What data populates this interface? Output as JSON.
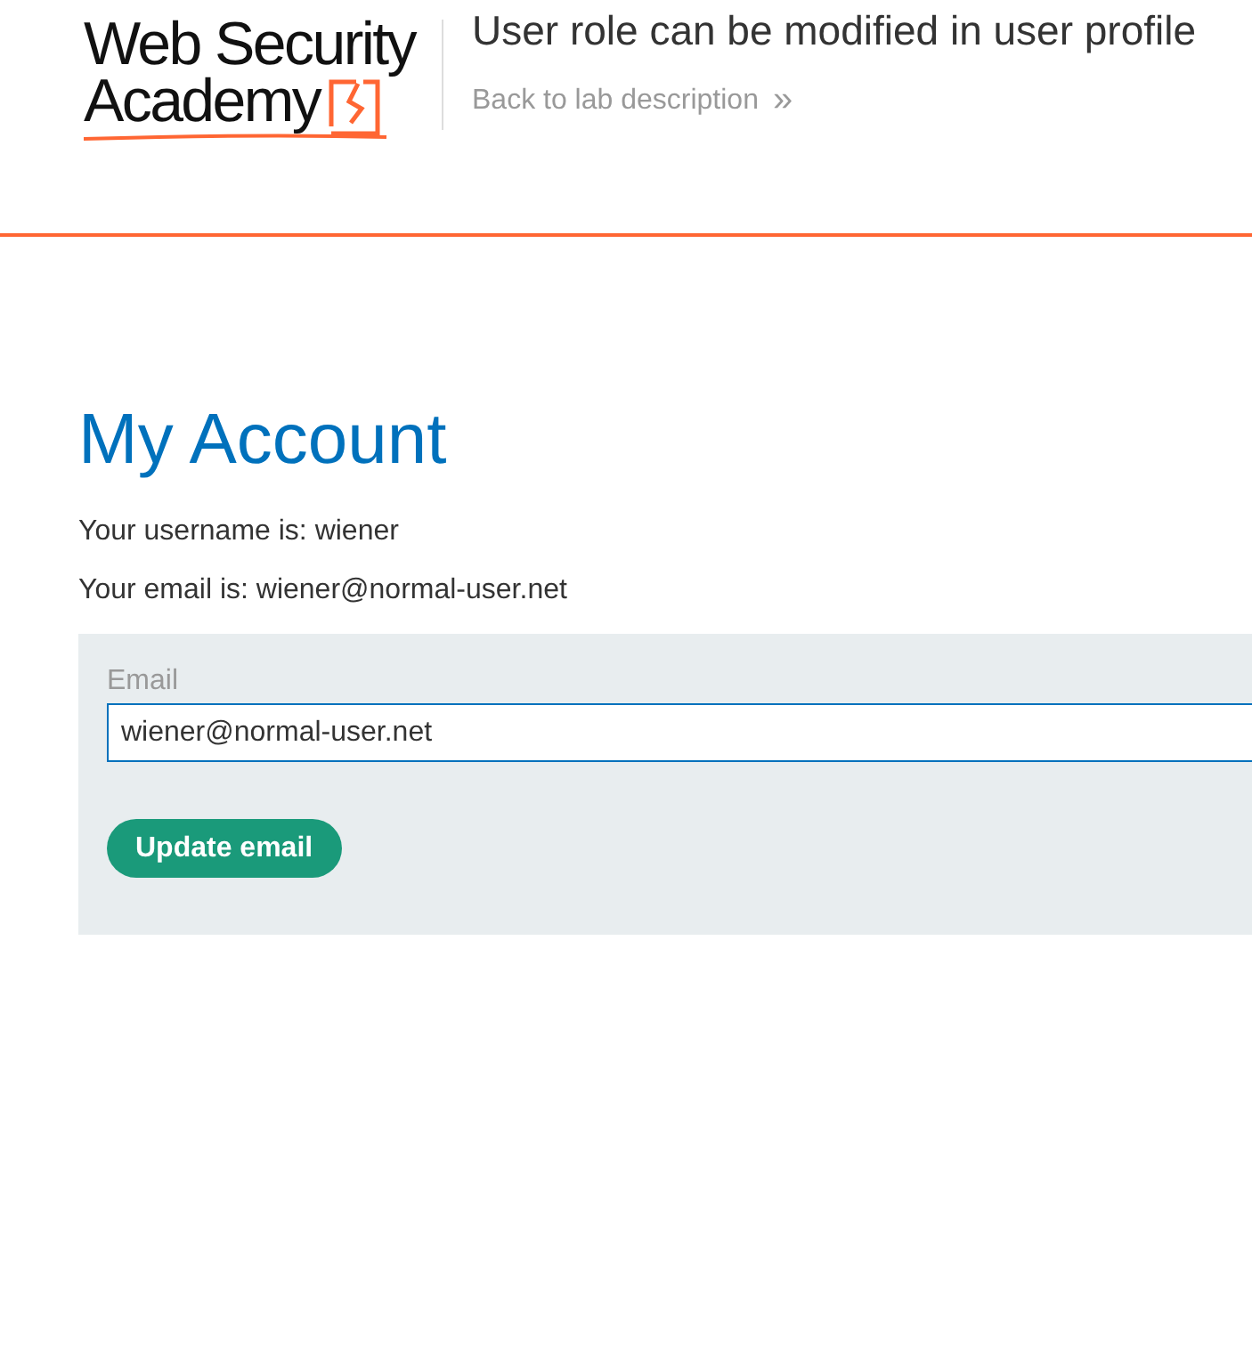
{
  "logo": {
    "line_1": "Web Security",
    "line_2": "Academy"
  },
  "lab_title": "User role can be modified in user profile",
  "back_link": {
    "label": "Back to lab description",
    "arrow": "»"
  },
  "heading": "My Account",
  "info": [
    "Your username is: wiener",
    "Your email is: wiener@normal-user.net"
  ],
  "form": {
    "label": "Email",
    "value": "wiener@normal-user.net",
    "button": "Update email"
  }
}
